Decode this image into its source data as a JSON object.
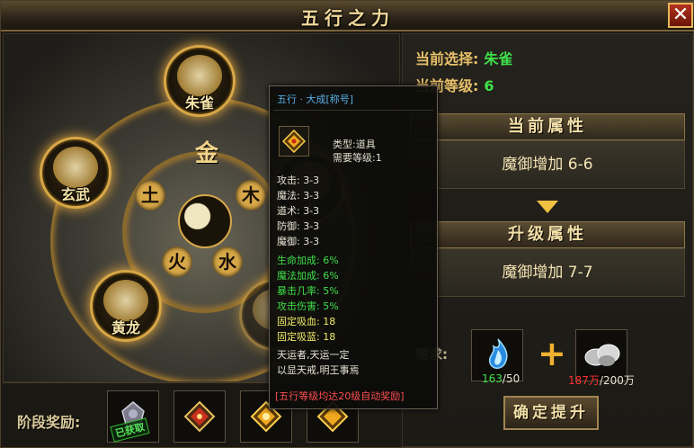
{
  "window": {
    "title": "五行之力",
    "close_label": "✕"
  },
  "wheel": {
    "nodes": [
      {
        "name": "朱雀",
        "icon": "phoenix-emblem"
      },
      {
        "name": "玄武",
        "icon": "tortoise-emblem"
      },
      {
        "name": "黄龙",
        "icon": "dragon-emblem"
      }
    ],
    "center_char": "金",
    "hidden_char": "虎"
  },
  "rewards": {
    "label": "阶段奖励:",
    "claimed_badge": "已获取",
    "slots": [
      {
        "icon": "gray-badge-icon",
        "claimed": true
      },
      {
        "icon": "red-gold-gem-icon",
        "claimed": false
      },
      {
        "icon": "gold-gem-icon",
        "claimed": false
      },
      {
        "icon": "gold-gem-icon",
        "claimed": false
      }
    ]
  },
  "info": {
    "selection_label": "当前选择:",
    "selection_value": "朱雀",
    "level_label": "当前等级:",
    "level_value": "6"
  },
  "current_attr": {
    "heading": "当前属性",
    "value": "魔御增加 6-6"
  },
  "upgrade_attr": {
    "heading": "升级属性",
    "value": "魔御增加 7-7"
  },
  "requirements": {
    "label": "需求:",
    "items": [
      {
        "icon": "blue-flame-icon",
        "have": "163",
        "need": "/50"
      },
      {
        "icon": "silver-ore-icon",
        "have": "187万",
        "need": "/200万"
      }
    ]
  },
  "confirm_label": "确定提升",
  "tooltip": {
    "title": "五行 · 大成[称号]",
    "type_line": "类型:道具",
    "level_line": "需要等级:1",
    "stats": [
      {
        "text": "攻击: 3-3",
        "tone": "white"
      },
      {
        "text": "魔法: 3-3",
        "tone": "white"
      },
      {
        "text": "道术: 3-3",
        "tone": "white"
      },
      {
        "text": "防御: 3-3",
        "tone": "white"
      },
      {
        "text": "魔御: 3-3",
        "tone": "white"
      },
      {
        "text": "生命加成: 6%",
        "tone": "green"
      },
      {
        "text": "魔法加成: 6%",
        "tone": "green"
      },
      {
        "text": "暴击几率: 5%",
        "tone": "green"
      },
      {
        "text": "攻击伤害: 5%",
        "tone": "green"
      },
      {
        "text": "固定吸血: 18",
        "tone": "yellow"
      },
      {
        "text": "固定吸蓝: 18",
        "tone": "yellow"
      }
    ],
    "desc_line1": "天运者,天运一定",
    "desc_line2": "以显天戒,明王事焉",
    "note": "[五行等级均达20级自动奖励]"
  },
  "colors": {
    "accent_gold": "#d8a848",
    "value_green": "#3fe04a",
    "warn_red": "#ff3030"
  }
}
